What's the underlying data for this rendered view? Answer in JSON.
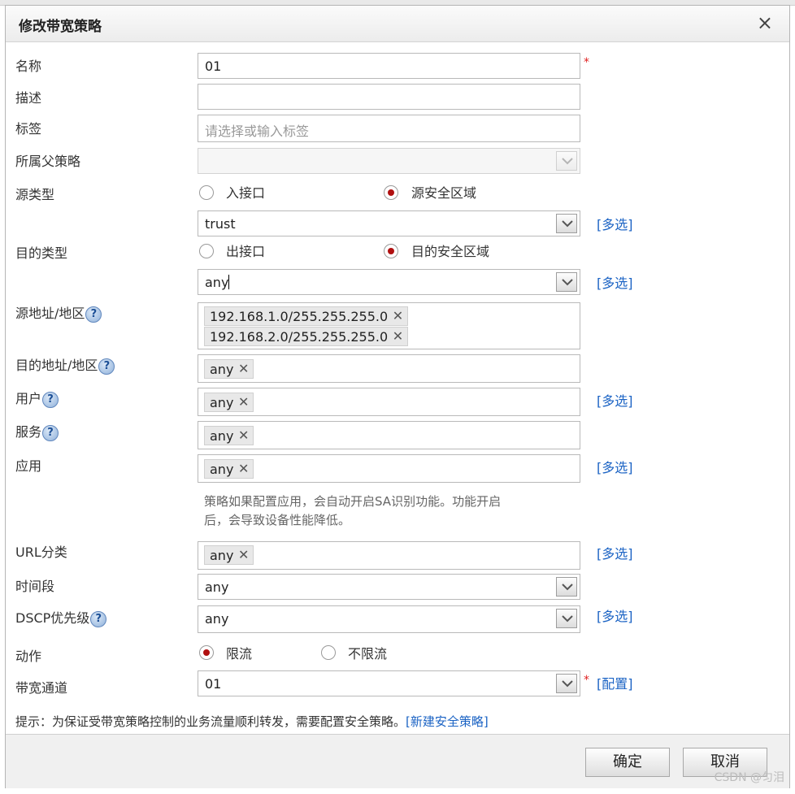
{
  "dialog": {
    "title": "修改带宽策略",
    "close": "×"
  },
  "fields": {
    "name": {
      "label": "名称",
      "value": "01",
      "required": "*"
    },
    "description": {
      "label": "描述",
      "value": ""
    },
    "tags": {
      "label": "标签",
      "placeholder": "请选择或输入标签"
    },
    "parent_policy": {
      "label": "所属父策略",
      "value": ""
    },
    "source_type": {
      "label": "源类型",
      "options": [
        "入接口",
        "源安全区域"
      ],
      "selected": "源安全区域",
      "zone_value": "trust",
      "multi_link": "[多选]"
    },
    "dest_type": {
      "label": "目的类型",
      "options": [
        "出接口",
        "目的安全区域"
      ],
      "selected": "目的安全区域",
      "zone_value": "any",
      "multi_link": "[多选]"
    },
    "source_address": {
      "label": "源地址/地区",
      "tags": [
        "192.168.1.0/255.255.255.0",
        "192.168.2.0/255.255.255.0"
      ]
    },
    "dest_address": {
      "label": "目的地址/地区",
      "tags": [
        "any"
      ]
    },
    "user": {
      "label": "用户",
      "tags": [
        "any"
      ],
      "multi_link": "[多选]"
    },
    "service": {
      "label": "服务",
      "tags": [
        "any"
      ]
    },
    "application": {
      "label": "应用",
      "tags": [
        "any"
      ],
      "multi_link": "[多选]",
      "note_line1": "策略如果配置应用，会自动开启SA识别功能。功能开启",
      "note_line2": "后，会导致设备性能降低。"
    },
    "url_category": {
      "label": "URL分类",
      "tags": [
        "any"
      ],
      "multi_link": "[多选]"
    },
    "time_range": {
      "label": "时间段",
      "value": "any"
    },
    "dscp": {
      "label": "DSCP优先级",
      "value": "any",
      "multi_link": "[多选]"
    },
    "action": {
      "label": "动作",
      "options": [
        "限流",
        "不限流"
      ],
      "selected": "限流"
    },
    "bandwidth_channel": {
      "label": "带宽通道",
      "value": "01",
      "required": "*",
      "config_link": "[配置]"
    }
  },
  "hint": {
    "text": "提示：为保证受带宽策略控制的业务流量顺利转发，需要配置安全策略。",
    "link": "[新建安全策略]"
  },
  "buttons": {
    "ok": "确定",
    "cancel": "取消"
  },
  "help_glyph": "?",
  "tag_remove_glyph": "✕",
  "watermark": "CSDN @匀泪",
  "icons": {
    "dropdown": "chevron-down-icon",
    "help": "help-icon",
    "remove": "close-icon"
  },
  "colors": {
    "link": "#1b63c4",
    "required": "#e02020",
    "radio_selected": "#b01010"
  }
}
